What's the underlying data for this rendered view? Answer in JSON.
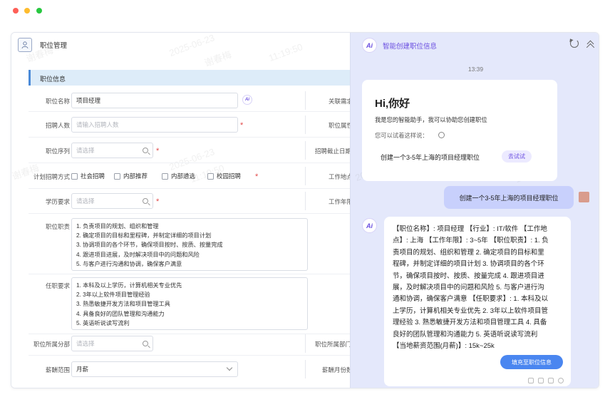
{
  "window_controls": {
    "close": "red",
    "minimize": "yellow",
    "maximize": "green"
  },
  "colors": {
    "accent": "#4b8ad8",
    "ai_purple": "#6a4ee0",
    "required": "#e24a4a",
    "panel_bg": "#e4e8fb",
    "user_bubble": "#c8d0fc",
    "fill_button": "#4a86f0"
  },
  "header": {
    "icon": "user-card-icon",
    "title": "职位管理"
  },
  "section": {
    "title": "职位信息"
  },
  "form": {
    "job_name": {
      "label": "职位名称",
      "value": "项目经理",
      "ai_icon": "ai-assist-icon"
    },
    "headcount": {
      "label": "招聘人数",
      "placeholder": "请输入招聘人数"
    },
    "sequence": {
      "label": "职位序列",
      "placeholder": "请选择"
    },
    "plan_method": {
      "label": "计划招聘方式",
      "options": [
        "社会招聘",
        "内部推荐",
        "内部遴选",
        "校园招聘"
      ]
    },
    "education": {
      "label": "学历要求",
      "placeholder": "请选择"
    },
    "duties": {
      "label": "职位职责",
      "lines": [
        "1. 负责项目的规划、组织和管理",
        "2. 确定项目的目标和里程碑，并制定详细的项目计划",
        "3. 协调项目的各个环节，确保项目按时、按质、按量完成",
        "4. 跟进项目进展，及时解决项目中的问题和风险",
        "5. 与客户进行沟通和协调，确保客户满意"
      ]
    },
    "requirements": {
      "label": "任职要求",
      "lines": [
        "1. 本科及以上学历，计算机相关专业优先",
        "2. 3年以上软件项目管理经验",
        "3. 熟悉敏捷开发方法和项目管理工具",
        "4. 具备良好的团队管理和沟通能力",
        "5. 英语听说读写流利"
      ]
    },
    "department": {
      "label": "职位所属分部",
      "placeholder": "请选择"
    },
    "salary_range": {
      "label": "薪酬范围",
      "value": "月薪"
    },
    "right_labels": [
      "关联需求",
      "职位属性",
      "招聘截止日期",
      "工作地点",
      "工作年限",
      "职位所属部门",
      "薪酬月份数"
    ]
  },
  "watermark": {
    "name": "谢春梅",
    "date": "2025-06-23",
    "time": "11:19:50"
  },
  "assistant": {
    "title": "智能创建职位信息",
    "time": "13:39",
    "greeting": "Hi,你好",
    "intro": "我是您的智能助手，我可以协助您创建职位",
    "hint": "您可以试着这样说：",
    "suggestion": "创建一个3-5年上海的项目经理职位",
    "try_label": "去试试",
    "user_message": "创建一个3-5年上海的项目经理职位",
    "answer_lines": [
      "【职位名称】: 项目经理 【行业】: IT/软件 【工作地",
      "点】: 上海 【工作年限】: 3~5年 【职位职责】: 1. 负",
      "责项目的规划、组织和管理 2. 确定项目的目标和里",
      "程碑，并制定详细的项目计划 3. 协调项目的各个环",
      "节，确保项目按时、按质、按量完成 4. 跟进项目进",
      "展，及时解决项目中的问题和风险 5. 与客户进行沟",
      "通和协调，确保客户满意 【任职要求】: 1. 本科及以",
      "上学历，计算机相关专业优先 2. 3年以上软件项目管",
      "理经验 3. 熟悉敏捷开发方法和项目管理工具 4. 具备",
      "良好的团队管理和沟通能力 5. 英语听说读写流利",
      "【当地薪资范围(月薪)】: 15k~25k"
    ],
    "fill_button": "填充至职位信息",
    "ai_badge": "Ai",
    "icons": [
      "refresh-icon",
      "collapse-icon",
      "copy-icon",
      "thumbs-up-icon",
      "thumbs-down-icon",
      "retry-icon"
    ]
  }
}
